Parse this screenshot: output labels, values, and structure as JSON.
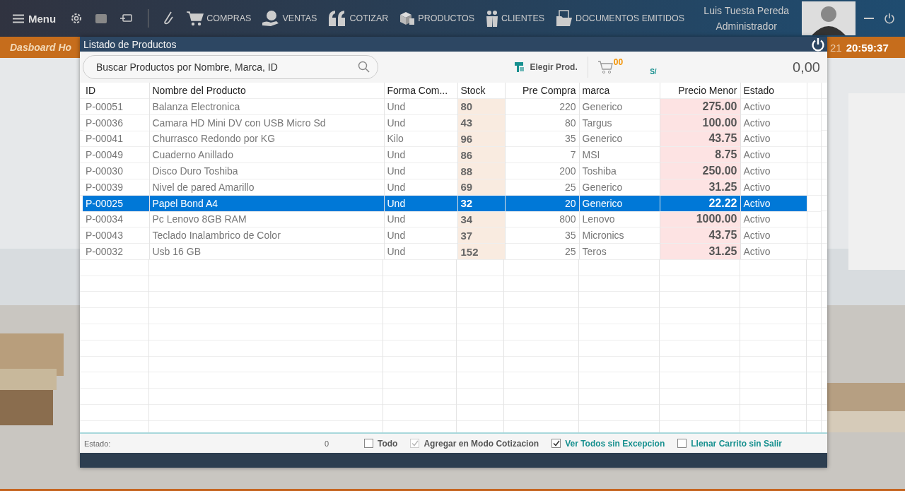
{
  "menu": {
    "label": "Menu"
  },
  "nav": [
    {
      "label": "COMPRAS",
      "kind": "cart"
    },
    {
      "label": "VENTAS",
      "kind": "money"
    },
    {
      "label": "COTIZAR",
      "kind": "quote"
    },
    {
      "label": "PRODUCTOS",
      "kind": "boxes"
    },
    {
      "label": "CLIENTES",
      "kind": "people"
    },
    {
      "label": "DOCUMENTOS EMITIDOS",
      "kind": "folder"
    }
  ],
  "user": {
    "name": "Luis Tuesta Pereda",
    "role": "Administrador"
  },
  "dashboard": {
    "title": "Dasboard Ho",
    "date_part": "21",
    "clock": "20:59:37"
  },
  "dialog": {
    "title": "Listado de Productos",
    "search": {
      "placeholder": "Buscar Productos por Nombre, Marca, ID"
    },
    "choose_button": "Elegir Prod.",
    "cart_count": "00",
    "currency": "S/",
    "total": "0,00",
    "table": {
      "columns": [
        {
          "label": "ID",
          "kind": "text"
        },
        {
          "label": "Nombre del Producto",
          "kind": "text"
        },
        {
          "label": "Forma Com...",
          "kind": "text"
        },
        {
          "label": "Stock",
          "kind": "stock"
        },
        {
          "label": "Pre Compra",
          "kind": "number"
        },
        {
          "label": "marca",
          "kind": "text"
        },
        {
          "label": "Precio Menor",
          "kind": "price"
        },
        {
          "label": "Estado",
          "kind": "text"
        }
      ],
      "rows": [
        {
          "cells": [
            "P-00051",
            "Balanza Electronica",
            "Und",
            "80",
            "220",
            "Generico",
            "275.00",
            "Activo"
          ],
          "selected": false
        },
        {
          "cells": [
            "P-00036",
            "Camara HD Mini DV con USB Micro Sd",
            "Und",
            "43",
            "80",
            "Targus",
            "100.00",
            "Activo"
          ],
          "selected": false
        },
        {
          "cells": [
            "P-00041",
            "Churrasco Redondo por KG",
            "Kilo",
            "96",
            "35",
            "Generico",
            "43.75",
            "Activo"
          ],
          "selected": false
        },
        {
          "cells": [
            "P-00049",
            "Cuaderno Anillado",
            "Und",
            "86",
            "7",
            "MSI",
            "8.75",
            "Activo"
          ],
          "selected": false
        },
        {
          "cells": [
            "P-00030",
            "Disco Duro Toshiba",
            "Und",
            "88",
            "200",
            "Toshiba",
            "250.00",
            "Activo"
          ],
          "selected": false
        },
        {
          "cells": [
            "P-00039",
            "Nivel de pared Amarillo",
            "Und",
            "69",
            "25",
            "Generico",
            "31.25",
            "Activo"
          ],
          "selected": false
        },
        {
          "cells": [
            "P-00025",
            "Papel Bond A4",
            "Und",
            "32",
            "20",
            "Generico",
            "22.22",
            "Activo"
          ],
          "selected": true
        },
        {
          "cells": [
            "P-00034",
            "Pc Lenovo 8GB RAM",
            "Und",
            "34",
            "800",
            "Lenovo",
            "1000.00",
            "Activo"
          ],
          "selected": false
        },
        {
          "cells": [
            "P-00043",
            "Teclado Inalambrico de Color",
            "Und",
            "37",
            "35",
            "Micronics",
            "43.75",
            "Activo"
          ],
          "selected": false
        },
        {
          "cells": [
            "P-00032",
            "Usb 16 GB",
            "Und",
            "152",
            "25",
            "Teros",
            "31.25",
            "Activo"
          ],
          "selected": false
        }
      ]
    },
    "status": {
      "label": "Estado:",
      "count": "0",
      "options": [
        {
          "label": "Todo",
          "checked": false,
          "disabled": false,
          "color": "#555555"
        },
        {
          "label": "Agregar en Modo Cotizacion",
          "checked": true,
          "disabled": true,
          "color": "#555555"
        },
        {
          "label": "Ver Todos sin Excepcion",
          "checked": true,
          "disabled": false,
          "color": "#17908f"
        },
        {
          "label": "Llenar Carrito sin Salir",
          "checked": false,
          "disabled": false,
          "color": "#17908f"
        }
      ]
    }
  }
}
